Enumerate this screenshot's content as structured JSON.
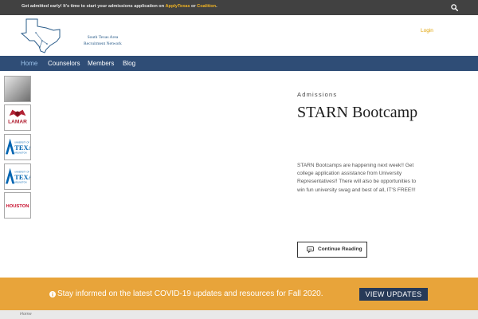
{
  "topbar": {
    "text_before": "Get admitted early! It's time to start your admissions application on ",
    "link_applytexas": "ApplyTexas",
    "text_or": " or ",
    "link_coalition": "Coalition",
    "text_end": ".",
    "search_icon": "search-icon"
  },
  "header": {
    "logo_line1": "South Texas Area",
    "logo_line2": "Recruitment Network",
    "login": "Login"
  },
  "nav": {
    "items": [
      {
        "label": "Home",
        "active": true
      },
      {
        "label": "Counselors"
      },
      {
        "label": "Members"
      },
      {
        "label": "Blog"
      }
    ]
  },
  "thumbnails": {
    "lamar": "LAMAR",
    "uta_small": "UNIVERSITY OF",
    "uta_big": "TEXAS",
    "uta_sub": "ARLINGTON",
    "houston": "HOUSTON"
  },
  "post": {
    "category": "Admissions",
    "title": "STARN Bootcamp",
    "excerpt": "STARN Bootcamps are happening next week!! Get college application assistance from University Representatives!! There will also be opportunities to win fun university swag and best of all, IT'S FREE!!!",
    "continue": "Continue Reading"
  },
  "banner": {
    "text": "Stay informed on the latest COVID-19 updates and resources for Fall 2020.",
    "button": "VIEW UPDATES",
    "color": "#e8a43a"
  },
  "breadcrumb": {
    "home": "Home"
  },
  "colors": {
    "nav_bg": "#2f4d76",
    "topbar_bg": "#414141",
    "accent": "#f0b323",
    "button_dark": "#273a58"
  }
}
